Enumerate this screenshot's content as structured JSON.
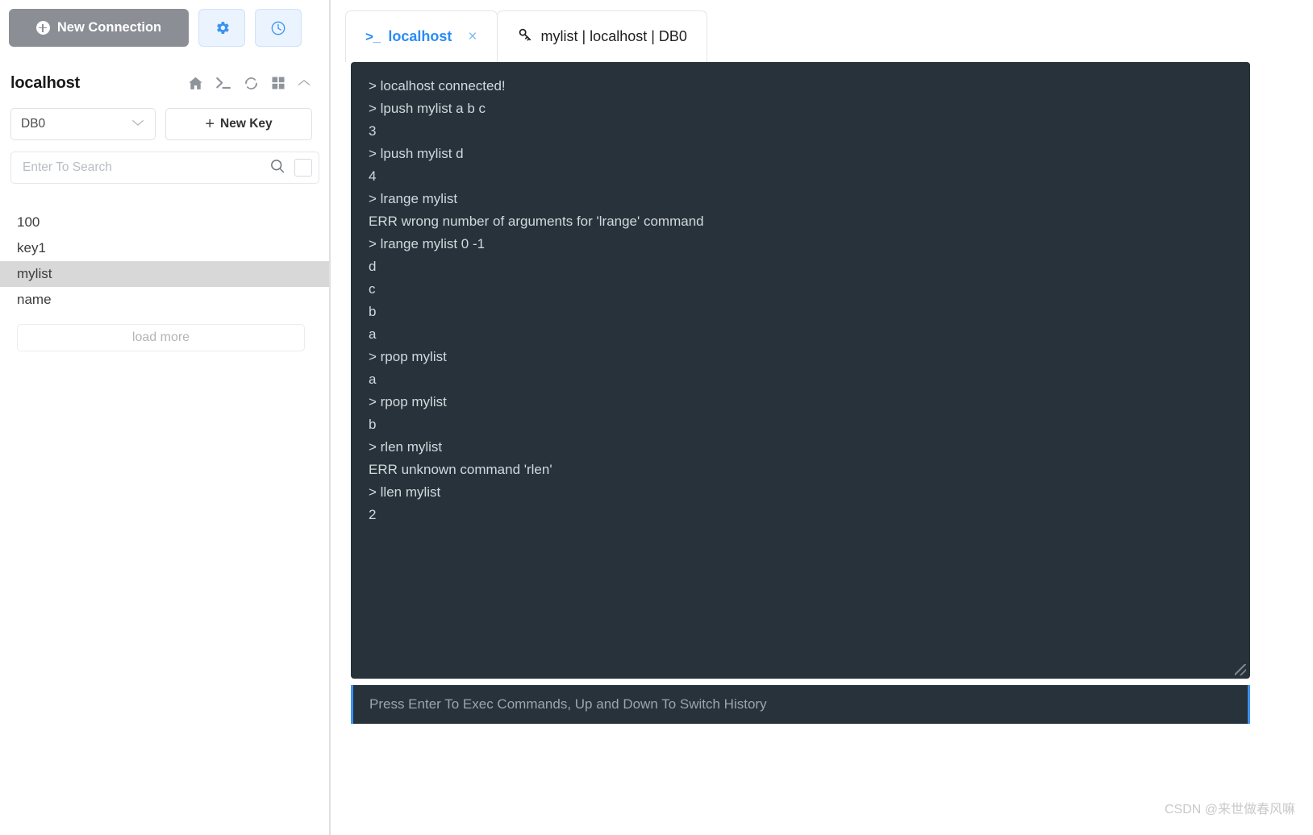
{
  "sidebar": {
    "new_connection_label": "New Connection",
    "settings_icon": "gear-icon",
    "history_icon": "clock-icon",
    "connection_name": "localhost",
    "header_icons": [
      "home-icon",
      "terminal-icon",
      "refresh-icon",
      "grid-icon",
      "chevron-up-icon"
    ],
    "db_selected": "DB0",
    "new_key_label": "New Key",
    "new_key_plus": "+",
    "search_placeholder": "Enter To Search",
    "search_value": "",
    "search_icon": "search-icon",
    "keys": [
      {
        "name": "100",
        "selected": false
      },
      {
        "name": "key1",
        "selected": false
      },
      {
        "name": "mylist",
        "selected": true
      },
      {
        "name": "name",
        "selected": false
      }
    ],
    "load_more_label": "load more"
  },
  "tabs": [
    {
      "label": "localhost",
      "icon": "terminal-prompt-icon",
      "prompt": ">_",
      "active": true,
      "closable": true,
      "close_glyph": "×"
    },
    {
      "label": "mylist | localhost | DB0",
      "icon": "key-icon",
      "active": false,
      "closable": false
    }
  ],
  "console": {
    "lines": [
      "> localhost connected!",
      "> lpush mylist a b c",
      "3",
      "> lpush mylist d",
      "4",
      "> lrange mylist",
      "ERR wrong number of arguments for 'lrange' command",
      "> lrange mylist 0 -1",
      "d",
      "c",
      "b",
      "a",
      "> rpop mylist",
      "a",
      "> rpop mylist",
      "b",
      "> rlen mylist",
      "ERR unknown command 'rlen'",
      "> llen mylist",
      "2"
    ],
    "input_placeholder": "Press Enter To Exec Commands, Up and Down To Switch History",
    "input_value": "",
    "resize_grip": "resize-grip-icon"
  },
  "watermark": "CSDN @来世做春风嘛",
  "colors": {
    "accent": "#2a8cf5",
    "console_bg": "#27323a",
    "console_text": "#d2d9dd",
    "new_connection_bg": "#8b8e95",
    "selected_key_bg": "#d8d8d8"
  }
}
